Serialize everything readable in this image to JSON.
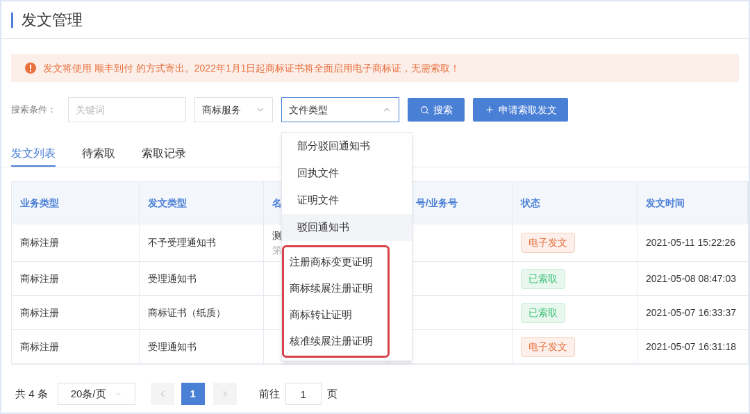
{
  "page_title": "发文管理",
  "alert": {
    "text": "发文将使用 顺丰到付 的方式寄出。2022年1月1日起商标证书将全面启用电子商标证，无需索取！"
  },
  "search": {
    "label": "搜索条件：",
    "keyword_placeholder": "关键词",
    "service_select": {
      "value": "商标服务",
      "open": false
    },
    "type_select": {
      "value": "文件类型",
      "open": true
    },
    "search_button": "搜索",
    "apply_button": "申请索取发文"
  },
  "tabs": [
    {
      "label": "发文列表",
      "selected": true
    },
    {
      "label": "待索取",
      "selected": false
    },
    {
      "label": "索取记录",
      "selected": false
    }
  ],
  "table": {
    "columns": [
      "业务类型",
      "发文类型",
      "名",
      "号/业务号",
      "状态",
      "发文时间"
    ],
    "rows": [
      {
        "cells": [
          "商标注册",
          "不予受理通知书",
          "测",
          "",
          ""
        ],
        "sub": "第",
        "status": {
          "text": "电子发文",
          "kind": "electronic"
        },
        "time": "2021-05-11 15:22:26"
      },
      {
        "cells": [
          "商标注册",
          "受理通知书",
          "",
          ""
        ],
        "status": {
          "text": "已索取",
          "kind": "retrieved"
        },
        "time": "2021-05-08 08:47:03"
      },
      {
        "cells": [
          "商标注册",
          "商标证书（纸质）",
          "",
          ""
        ],
        "status": {
          "text": "已索取",
          "kind": "retrieved"
        },
        "time": "2021-05-07 16:33:37"
      },
      {
        "cells": [
          "商标注册",
          "受理通知书",
          "",
          ""
        ],
        "status": {
          "text": "电子发文",
          "kind": "electronic"
        },
        "time": "2021-05-07 16:31:18"
      }
    ]
  },
  "dropdown": {
    "items": [
      {
        "label": "部分驳回通知书",
        "highlighted": false
      },
      {
        "label": "回执文件",
        "highlighted": false
      },
      {
        "label": "证明文件",
        "highlighted": false
      },
      {
        "label": "驳回通知书",
        "highlighted": true
      }
    ],
    "marked_items": [
      {
        "label": "注册商标变更证明",
        "highlighted": false
      },
      {
        "label": "商标续展注册证明",
        "highlighted": false
      },
      {
        "label": "商标转让证明",
        "highlighted": false
      },
      {
        "label": "核准续展注册证明",
        "highlighted": false
      }
    ]
  },
  "pagination": {
    "total": "共 4 条",
    "page_size": "20条/页",
    "pages": [
      {
        "label": "1",
        "selected": true
      }
    ],
    "goto_label": "前往",
    "goto_value": "1",
    "goto_suffix": "页"
  }
}
